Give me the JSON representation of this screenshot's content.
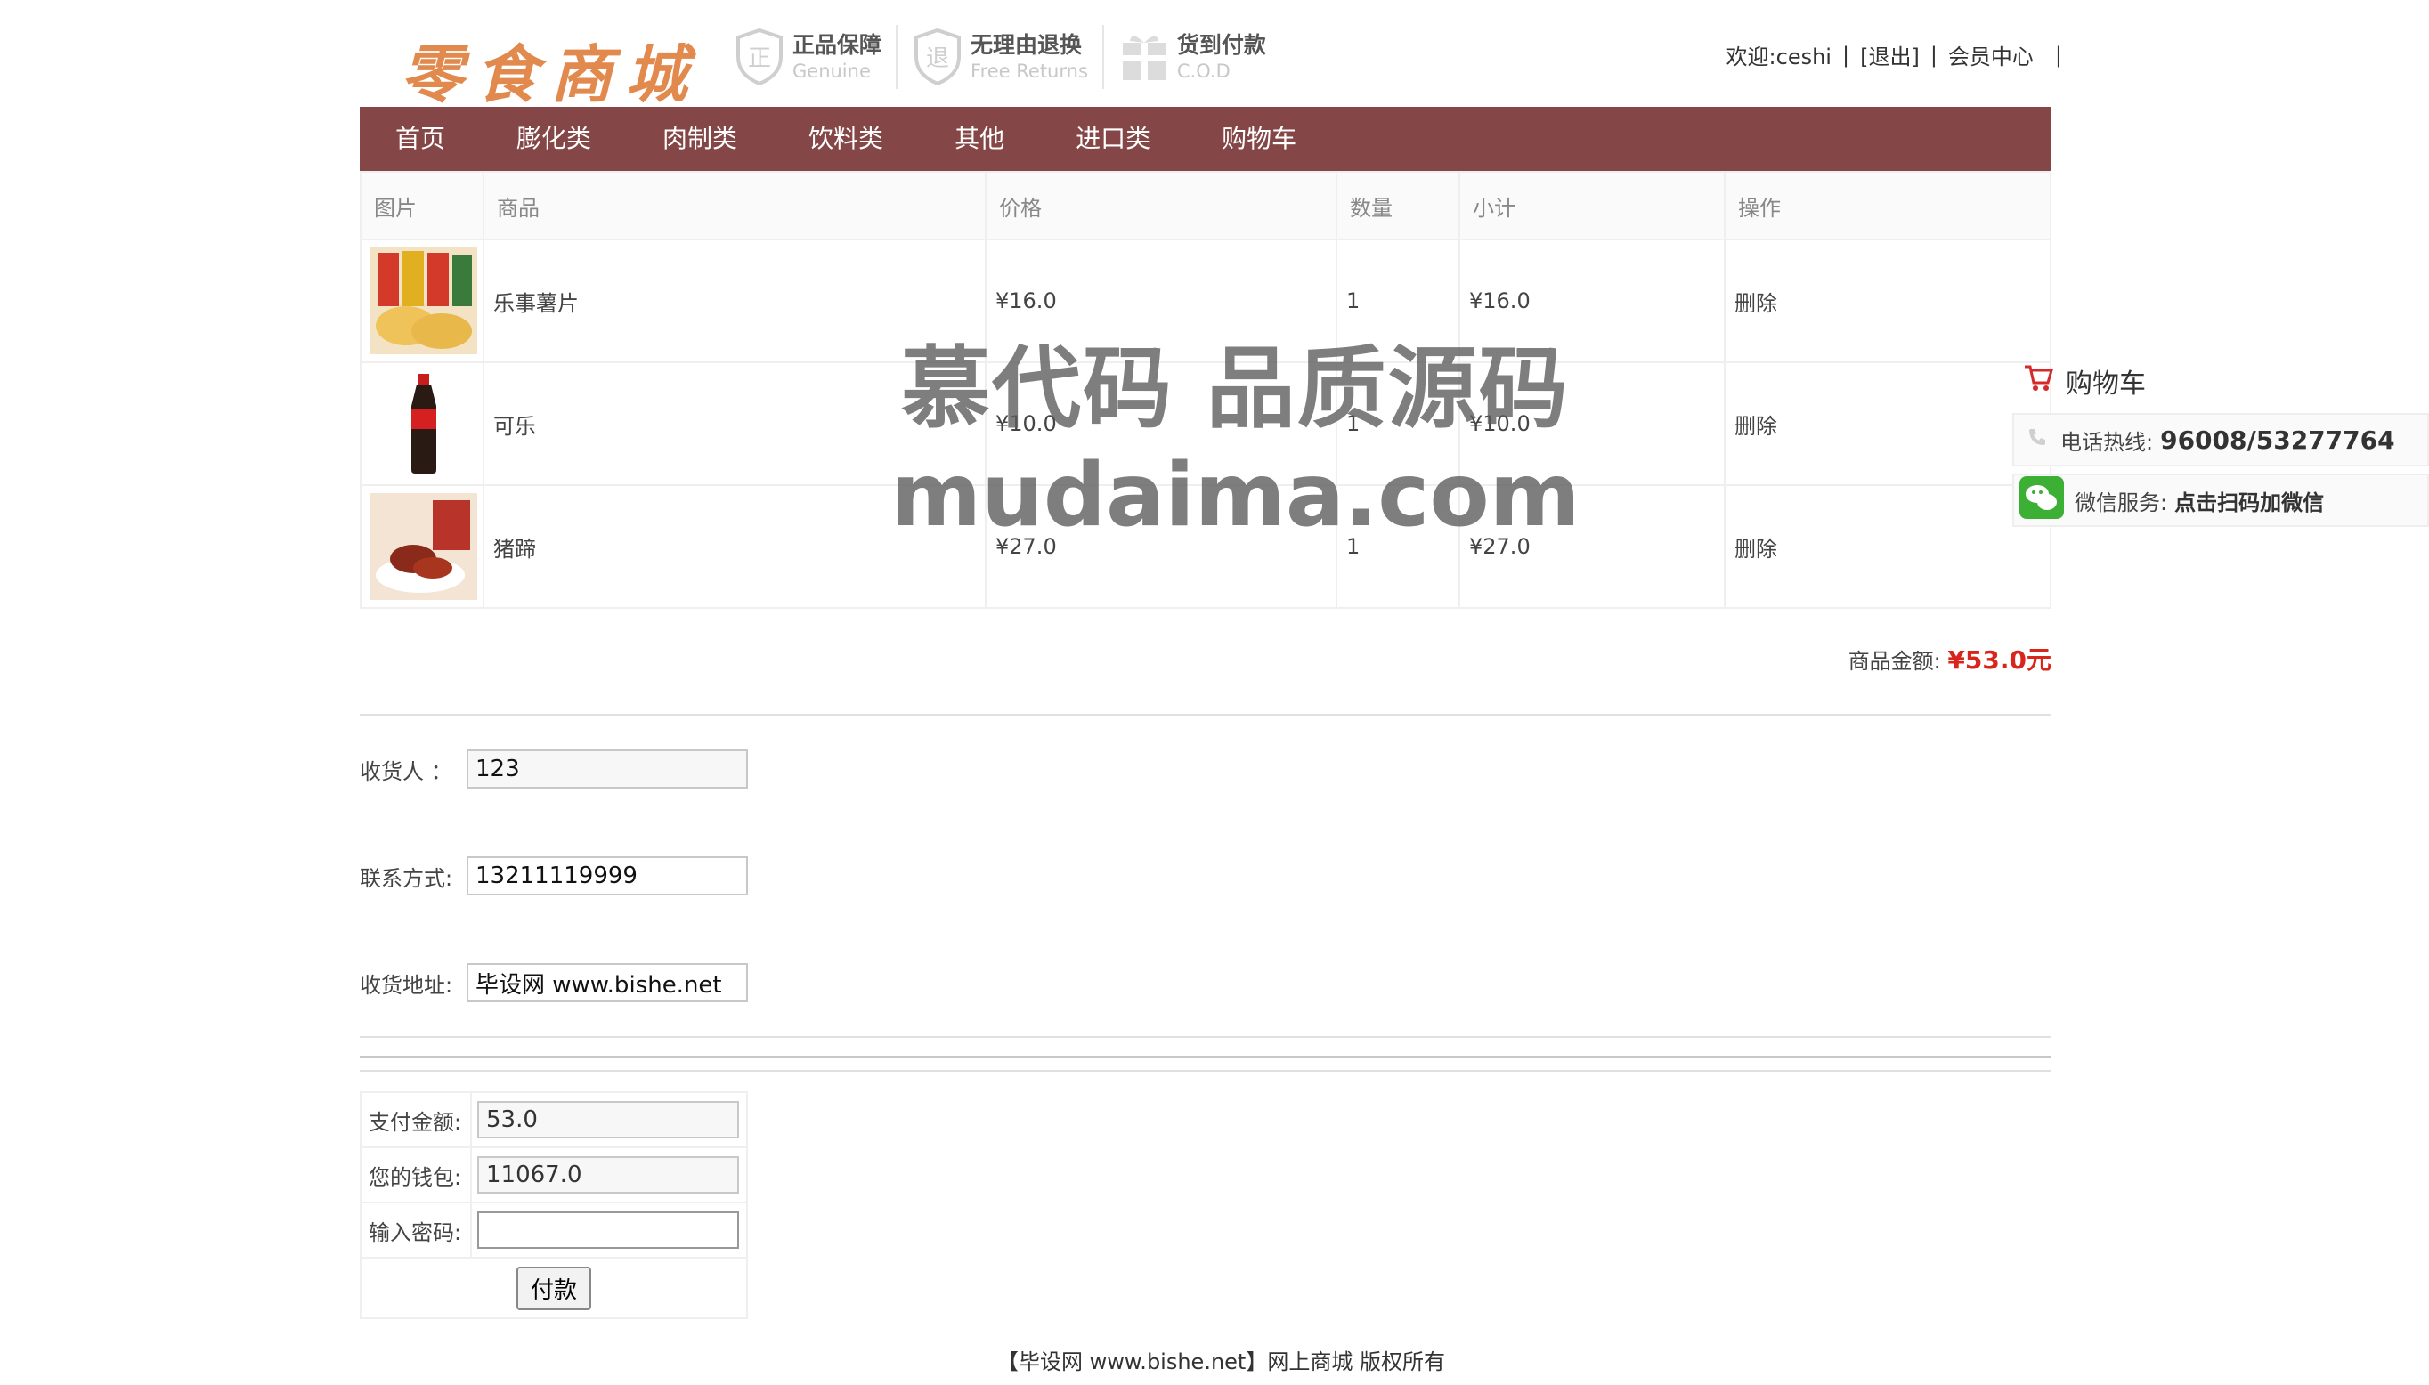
{
  "header": {
    "logo_text": "零食商城",
    "badges": [
      {
        "title": "正品保障",
        "sub": "Genuine",
        "icon": "shield-zheng-icon"
      },
      {
        "title": "无理由退换",
        "sub": "Free Returns",
        "icon": "shield-tui-icon"
      },
      {
        "title": "货到付款",
        "sub": "C.O.D",
        "icon": "gift-box-icon"
      }
    ],
    "user": {
      "welcome": "欢迎:ceshi",
      "logout": "[退出]",
      "member": "会员中心",
      "sep": "|"
    }
  },
  "nav": [
    "首页",
    "膨化类",
    "肉制类",
    "饮料类",
    "其他",
    "进口类",
    "购物车"
  ],
  "cart": {
    "headers": [
      "图片",
      "商品",
      "价格",
      "数量",
      "小计",
      "操作"
    ],
    "rows": [
      {
        "name": "乐事薯片",
        "price": "¥16.0",
        "qty": "1",
        "subtotal": "¥16.0",
        "action": "删除"
      },
      {
        "name": "可乐",
        "price": "¥10.0",
        "qty": "1",
        "subtotal": "¥10.0",
        "action": "删除"
      },
      {
        "name": "猪蹄",
        "price": "¥27.0",
        "qty": "1",
        "subtotal": "¥27.0",
        "action": "删除"
      }
    ],
    "total_label": "商品金额:",
    "total_value": "¥53.0元"
  },
  "form": {
    "receiver_label": "收货人 ：",
    "receiver_value": "123",
    "contact_label": "联系方式:",
    "contact_value": "13211119999",
    "address_label": "收货地址:",
    "address_value": "毕设网 www.bishe.net"
  },
  "payment": {
    "amount_label": "支付金额:",
    "amount_value": "53.0",
    "wallet_label": "您的钱包:",
    "wallet_value": "11067.0",
    "password_label": "输入密码:",
    "password_value": "",
    "pay_button": "付款"
  },
  "footer": "【毕设网 www.bishe.net】网上商城 版权所有",
  "side": {
    "cart": "购物车",
    "hotline_label": "电话热线:",
    "hotline_value": "96008/53277764",
    "wechat_label": "微信服务:",
    "wechat_value": "点击扫码加微信"
  },
  "watermark": {
    "line1": "慕代码 品质源码",
    "line2": "mudaima.com"
  },
  "colors": {
    "nav_bg": "#844646",
    "price_red": "#d9261c",
    "logo": "#e2894e"
  }
}
